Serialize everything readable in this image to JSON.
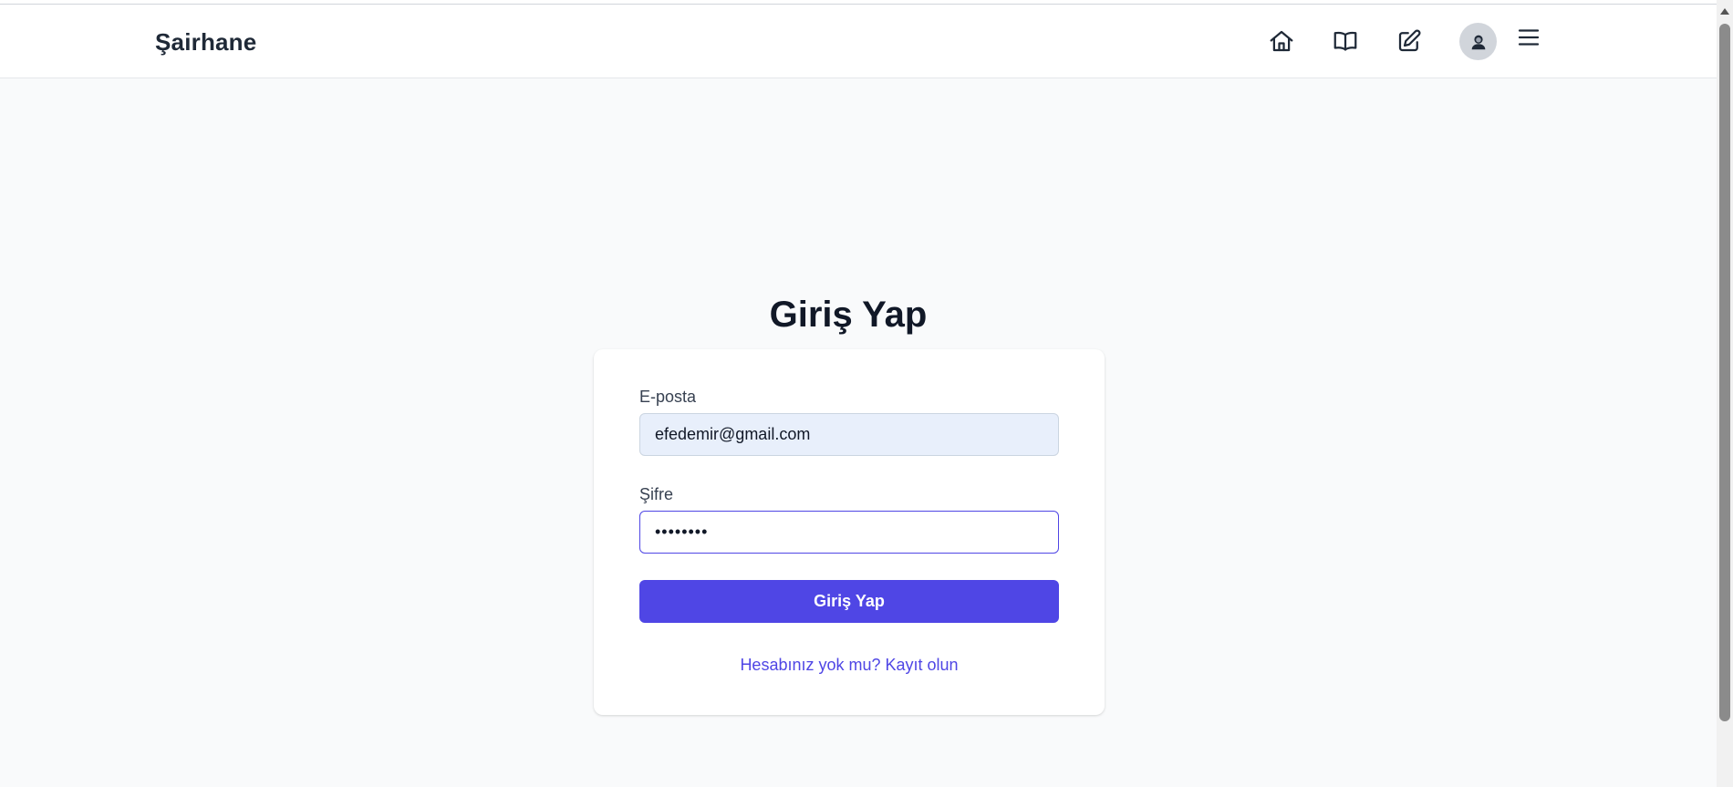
{
  "header": {
    "brand": "Şairhane",
    "icons": {
      "home": "home-icon",
      "book": "book-icon",
      "edit": "edit-icon",
      "avatar": "avatar",
      "menu": "menu-icon"
    }
  },
  "login": {
    "title": "Giriş Yap",
    "email_label": "E-posta",
    "email_value": "efedemir@gmail.com",
    "password_label": "Şifre",
    "password_value": "••••••••",
    "submit_label": "Giriş Yap",
    "register_link": "Hesabınız yok mu? Kayıt olun"
  },
  "colors": {
    "accent": "#4f46e5",
    "background": "#f9fafb",
    "card": "#ffffff",
    "autofill": "#e8effb"
  }
}
